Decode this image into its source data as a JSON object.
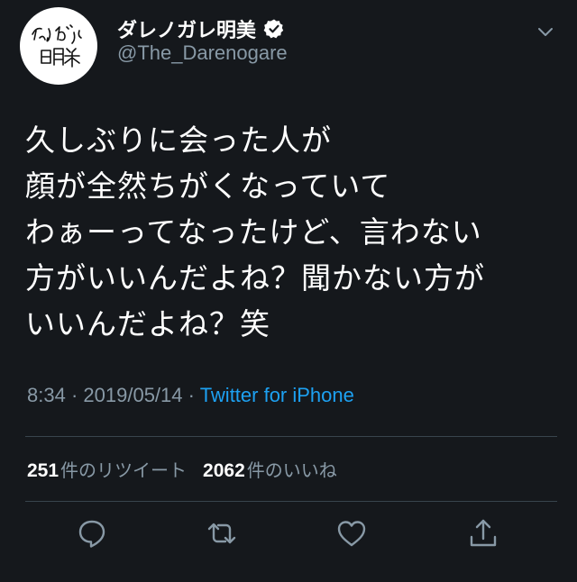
{
  "author": {
    "display_name": "ダレノガレ明美",
    "handle": "@The_Darenogare",
    "verified": true,
    "avatar_icon": "avatar-handwritten-logo"
  },
  "tweet": {
    "lines": [
      "久しぶりに会った人が",
      "顔が全然ちがくなっていて",
      "わぁーってなったけど、言わない",
      "方がいいんだよね？聞かない方が",
      "いいんだよね？笑"
    ],
    "time": "8:34",
    "date": "2019/05/14",
    "separator": "·",
    "source": "Twitter for iPhone"
  },
  "stats": {
    "retweets_count": "251",
    "retweets_label": "件のリツイート",
    "likes_count": "2062",
    "likes_label": "件のいいね"
  },
  "actions": [
    {
      "icon": "reply-icon"
    },
    {
      "icon": "retweet-icon"
    },
    {
      "icon": "like-icon"
    },
    {
      "icon": "share-icon"
    }
  ],
  "colors": {
    "background": "#15181c",
    "text": "#ffffff",
    "secondary": "#8899a6",
    "accent": "#1da1f2",
    "divider": "#38444d"
  }
}
